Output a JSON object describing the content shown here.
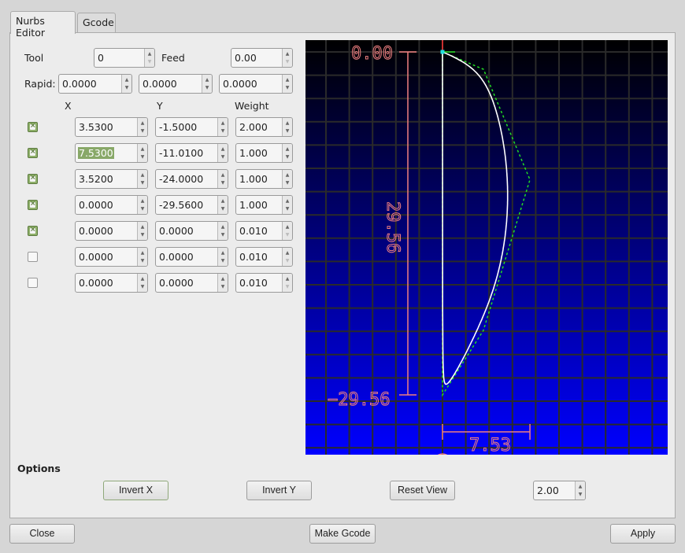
{
  "tabs": [
    {
      "label": "Nurbs Editor",
      "active": true
    },
    {
      "label": "Gcode",
      "active": false
    }
  ],
  "tool": {
    "label": "Tool",
    "value": "0"
  },
  "feed": {
    "label": "Feed",
    "value": "0.00"
  },
  "rapid": {
    "label": "Rapid:",
    "x": "0.0000",
    "y": "0.0000",
    "z": "0.0000"
  },
  "columns": {
    "x": "X",
    "y": "Y",
    "weight": "Weight"
  },
  "points": [
    {
      "enabled": true,
      "x": "3.5300",
      "y": "-1.5000",
      "weight": "2.000"
    },
    {
      "enabled": true,
      "x": "7.5300",
      "y": "-11.0100",
      "weight": "1.000",
      "selected": true
    },
    {
      "enabled": true,
      "x": "3.5200",
      "y": "-24.0000",
      "weight": "1.000"
    },
    {
      "enabled": true,
      "x": "0.0000",
      "y": "-29.5600",
      "weight": "1.000"
    },
    {
      "enabled": true,
      "x": "0.0000",
      "y": "0.0000",
      "weight": "0.010"
    },
    {
      "enabled": false,
      "x": "0.0000",
      "y": "0.0000",
      "weight": "0.010"
    },
    {
      "enabled": false,
      "x": "0.0000",
      "y": "0.0000",
      "weight": "0.010"
    }
  ],
  "preview": {
    "dim_top_label": "0.00",
    "dim_height_label": "29.56",
    "dim_bottom_label": "−29.56",
    "dim_width_label": "7.53",
    "colors": {
      "bg_top": "#000000",
      "bg_bottom": "#0000ff",
      "grid": "#2a2a2a",
      "curve": "#ffffff",
      "control_polygon": "#22dd22",
      "dimension": "#f08080",
      "start_marker": "#22dddd",
      "axis_tick": "#ff3333"
    },
    "control_points": [
      [
        0,
        0
      ],
      [
        3.53,
        -1.5
      ],
      [
        7.53,
        -11.01
      ],
      [
        3.52,
        -24.0
      ],
      [
        0,
        -29.56
      ],
      [
        0,
        0
      ]
    ],
    "weights": [
      1.0,
      2.0,
      1.0,
      1.0,
      1.0,
      0.01
    ]
  },
  "options": {
    "title": "Options",
    "invert_x": "Invert X",
    "invert_y": "Invert Y",
    "reset_view": "Reset View",
    "zoom_value": "2.00"
  },
  "footer": {
    "close": "Close",
    "make_gcode": "Make Gcode",
    "apply": "Apply"
  }
}
